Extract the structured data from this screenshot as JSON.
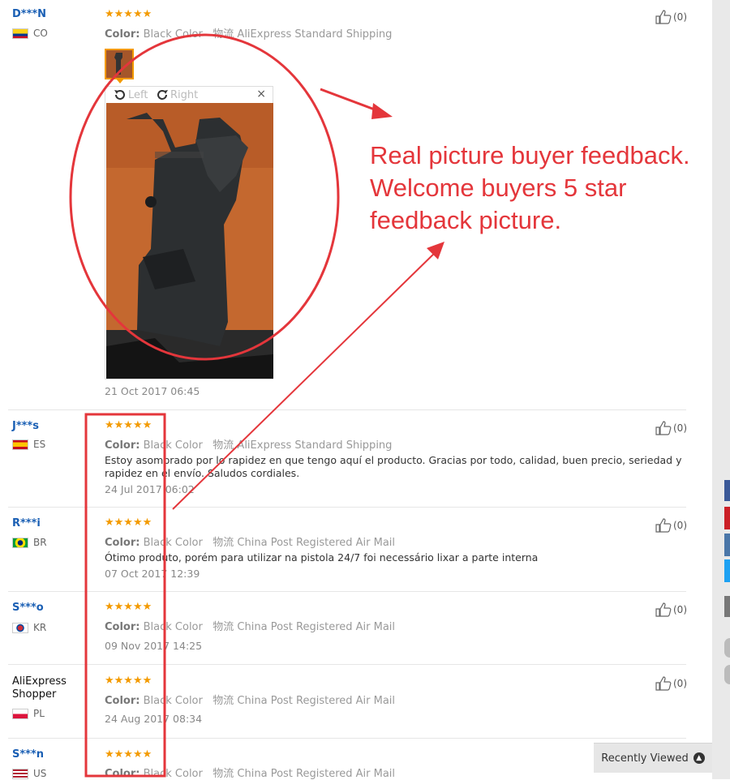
{
  "reviews": [
    {
      "user": "D***N",
      "country": "CO",
      "flag": "colombia",
      "color_label": "Color:",
      "color_value": "Black Color",
      "shipping": "AliExpress Standard Shipping",
      "body": "",
      "date": "21 Oct 2017 06:45",
      "likes": "(0)",
      "rating": 5
    },
    {
      "user": "J***s",
      "country": "ES",
      "flag": "spain",
      "color_label": "Color:",
      "color_value": "Black Color",
      "shipping": "AliExpress Standard Shipping",
      "body": "Estoy asombrado por lo rapidez en que tengo aquí el producto. Gracias por todo, calidad, buen precio, seriedad y rapidez en el envío. Saludos cordiales.",
      "date": "24 Jul 2017 06:02",
      "likes": "(0)",
      "rating": 5
    },
    {
      "user": "R***i",
      "country": "BR",
      "flag": "brazil",
      "color_label": "Color:",
      "color_value": "Black Color",
      "shipping": "China Post Registered Air Mail",
      "body": "Ótimo produto, porém para utilizar na pistola 24/7 foi necessário lixar a parte interna",
      "date": "07 Oct 2017 12:39",
      "likes": "(0)",
      "rating": 5
    },
    {
      "user": "S***o",
      "country": "KR",
      "flag": "korea",
      "color_label": "Color:",
      "color_value": "Black Color",
      "shipping": "China Post Registered Air Mail",
      "body": "",
      "date": "09 Nov 2017 14:25",
      "likes": "(0)",
      "rating": 5
    },
    {
      "user": "AliExpress Shopper",
      "country": "PL",
      "flag": "poland",
      "color_label": "Color:",
      "color_value": "Black Color",
      "shipping": "China Post Registered Air Mail",
      "body": "",
      "date": "24 Aug 2017 08:34",
      "likes": "(0)",
      "rating": 5
    },
    {
      "user": "S***n",
      "country": "US",
      "flag": "usa",
      "color_label": "Color:",
      "color_value": "Black Color",
      "shipping": "China Post Registered Air Mail",
      "body": "",
      "date": "",
      "likes": "",
      "rating": 5
    }
  ],
  "shipping_prefix": "物流",
  "stars_text": "★★★★★",
  "viewer": {
    "rotate_left": "Left",
    "rotate_right": "Right",
    "close": "×"
  },
  "annotation": {
    "line1": "Real picture buyer feedback.",
    "line2": "Welcome buyers 5 star",
    "line3": "feedback picture.",
    "color": "#e4363b"
  },
  "recently_viewed": {
    "label": "Recently Viewed",
    "icon": "chevron-up-icon"
  },
  "colors": {
    "star": "#f39a00",
    "username": "#1a5fb4",
    "annotation_red": "#e4363b"
  }
}
